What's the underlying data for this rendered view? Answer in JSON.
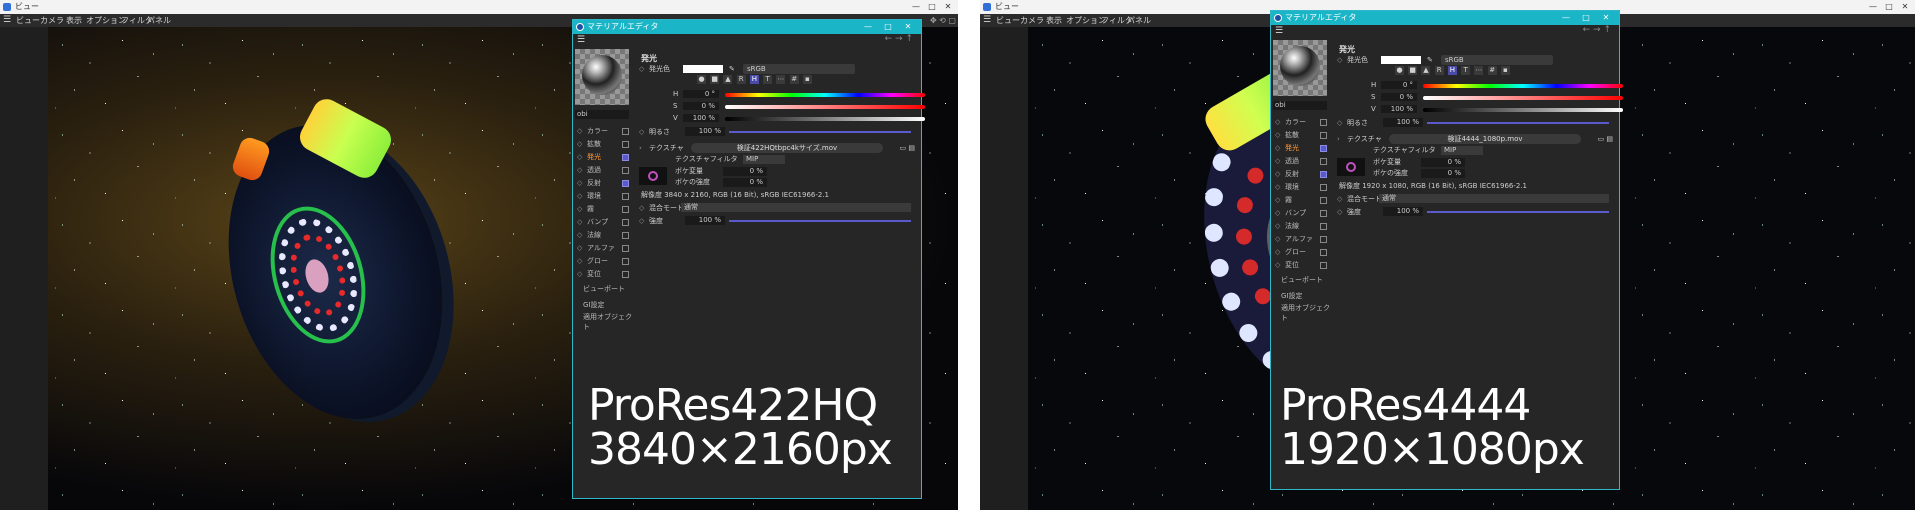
{
  "window": {
    "title": "ビュー",
    "controls": [
      "—",
      "□",
      "✕"
    ]
  },
  "menu": {
    "items": [
      "ビュー",
      "カメラ",
      "表示",
      "オプション",
      "フィルタ",
      "パネル"
    ]
  },
  "editor": {
    "title": "マテリアルエディタ",
    "controls": [
      "—",
      "□",
      "✕"
    ],
    "nav_arrows": "← → ↑",
    "object_name": "obi",
    "section_title": "発光",
    "emission_color_label": "発光色",
    "color_space": "sRGB",
    "tool_buttons": [
      "R",
      "H",
      "T",
      "⋯",
      "#",
      "▪"
    ],
    "hsv": [
      {
        "label": "H",
        "value": "0 °"
      },
      {
        "label": "S",
        "value": "0 %"
      },
      {
        "label": "V",
        "value": "100 %"
      }
    ],
    "brightness_label": "明るさ",
    "brightness_value": "100 %",
    "texture_label": "テクスチャ",
    "texture_filter_label": "テクスチャフィルタ",
    "texture_filter_value": "MIP",
    "blur_offset_label": "ボケ変量",
    "blur_offset_value": "0 %",
    "blur_strength_label": "ボケの強度",
    "blur_strength_value": "0 %",
    "blend_mode_label": "混合モード",
    "blend_mode_value": "通常",
    "strength_label": "強度",
    "strength_value": "100 %",
    "channels": [
      {
        "label": "カラー",
        "checked": false
      },
      {
        "label": "拡散",
        "checked": false
      },
      {
        "label": "発光",
        "checked": true,
        "active": true
      },
      {
        "label": "透過",
        "checked": false
      },
      {
        "label": "反射",
        "checked": true
      },
      {
        "label": "環境",
        "checked": false
      },
      {
        "label": "霧",
        "checked": false
      },
      {
        "label": "バンプ",
        "checked": false
      },
      {
        "label": "法線",
        "checked": false
      },
      {
        "label": "アルファ",
        "checked": false
      },
      {
        "label": "グロー",
        "checked": false
      },
      {
        "label": "変位",
        "checked": false
      }
    ],
    "links": [
      "ビューポート",
      "GI設定",
      "適用オブジェクト"
    ]
  },
  "panels": [
    {
      "texture_file": "検証422HQtbpc4kサイズ.mov",
      "resolution_info": "解像度 3840 x 2160, RGB (16 Bit), sRGB IEC61966-2.1",
      "overlay_line1": "ProRes422HQ",
      "overlay_line2": "3840×2160px"
    },
    {
      "texture_file": "検証4444_1080p.mov",
      "resolution_info": "解像度 1920 x 1080, RGB (16 Bit), sRGB IEC61966-2.1",
      "overlay_line1": "ProRes4444",
      "overlay_line2": "1920×1080px"
    }
  ],
  "colors": {
    "editor_accent": "#1ab5c6",
    "highlight": "#5a5acc",
    "active_channel": "#ff9a3a"
  }
}
